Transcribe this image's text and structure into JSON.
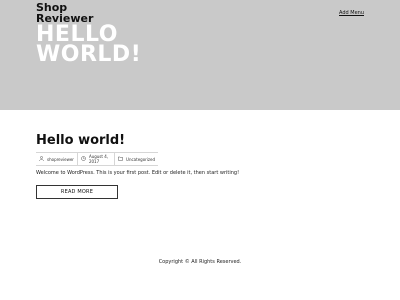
{
  "header": {
    "site_title_line1": "Shop",
    "site_title_line2": "Reviewer",
    "menu_label": "Add Menu"
  },
  "hero": {
    "heading_line1": "HELLO",
    "heading_line2": "WORLD!",
    "background_color": "#c9c9c9"
  },
  "post": {
    "title": "Hello world!",
    "meta": {
      "author": "shopreviewer",
      "author_icon": "user-icon",
      "date": "August 4, 2017",
      "date_icon": "clock-icon",
      "category": "Uncategorized",
      "category_icon": "folder-icon"
    },
    "excerpt": "Welcome to WordPress. This is your first post. Edit or delete it, then start writing!",
    "read_more_label": "READ MORE"
  },
  "footer": {
    "copyright": "Copyright © All Rights Reserved."
  }
}
